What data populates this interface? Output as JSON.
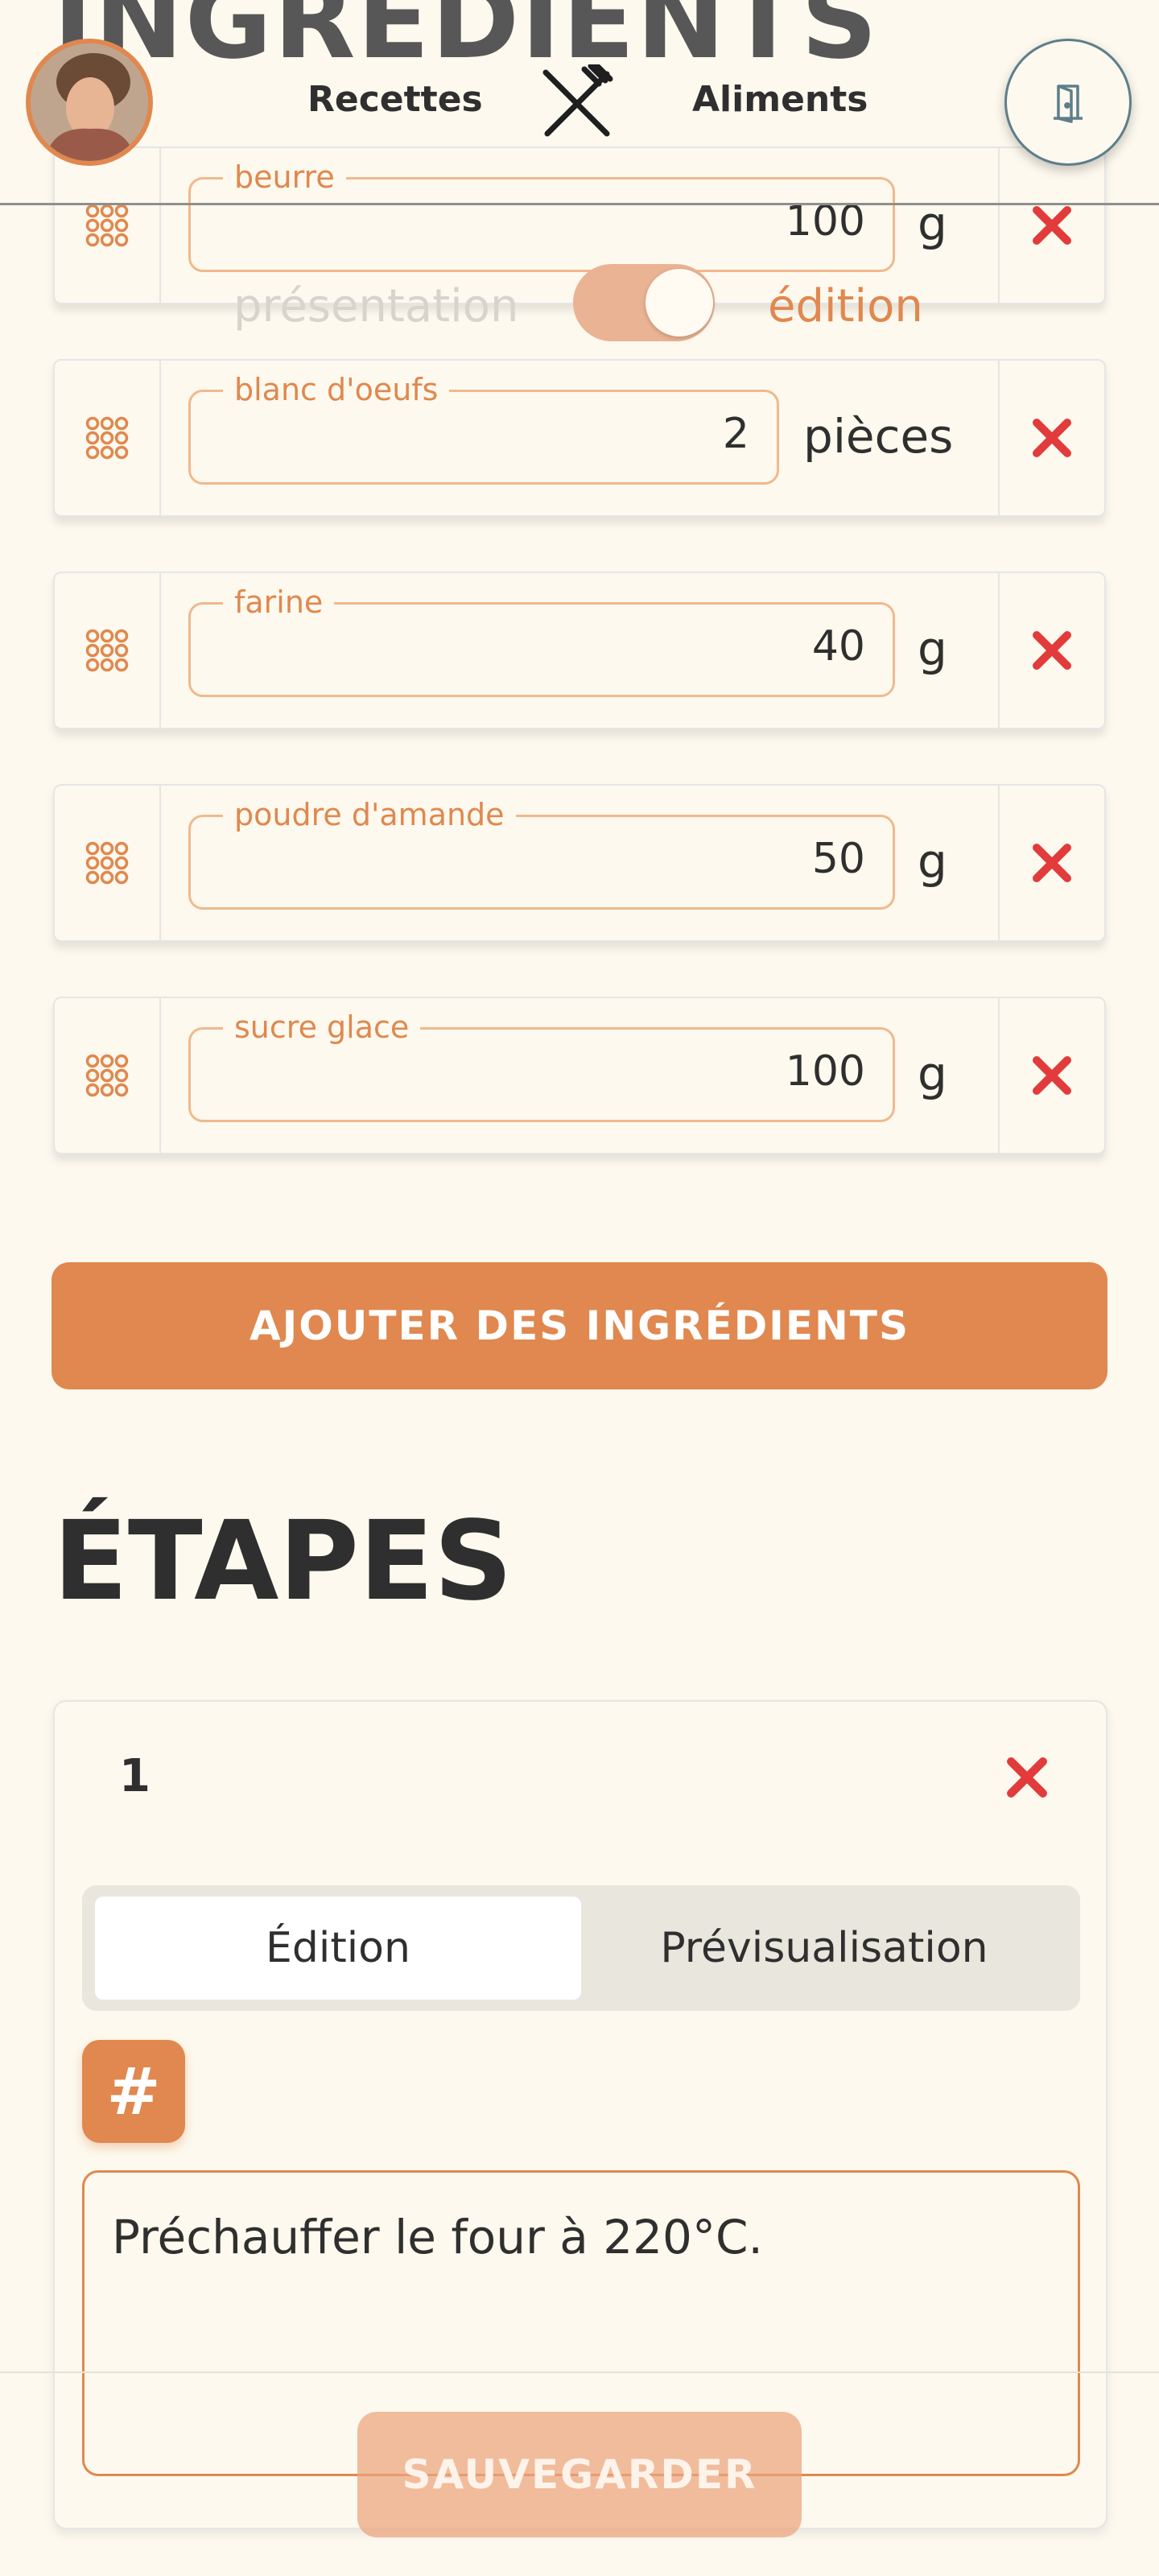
{
  "header": {
    "title": "INGRÉDIENTS",
    "nav_recipes": "Recettes",
    "nav_foods": "Aliments"
  },
  "mode": {
    "presentation": "présentation",
    "edition": "édition",
    "value": "édition"
  },
  "ingredients": [
    {
      "name": "beurre",
      "quantity": "100",
      "unit": "g"
    },
    {
      "name": "blanc d'oeufs",
      "quantity": "2",
      "unit": "pièces"
    },
    {
      "name": "farine",
      "quantity": "40",
      "unit": "g"
    },
    {
      "name": "poudre d'amande",
      "quantity": "50",
      "unit": "g"
    },
    {
      "name": "sucre glace",
      "quantity": "100",
      "unit": "g"
    }
  ],
  "add_ingredients_label": "AJOUTER DES INGRÉDIENTS",
  "steps_title": "ÉTAPES",
  "steps": [
    {
      "number": "1",
      "text": "Préchauffer le four à 220°C."
    }
  ],
  "step_tabs": {
    "edit": "Édition",
    "preview": "Prévisualisation"
  },
  "heading_button": "#",
  "save_label": "SAUVEGARDER",
  "colors": {
    "accent": "#e0884f",
    "delete": "#e23b3b",
    "background": "#fdf9ee"
  }
}
